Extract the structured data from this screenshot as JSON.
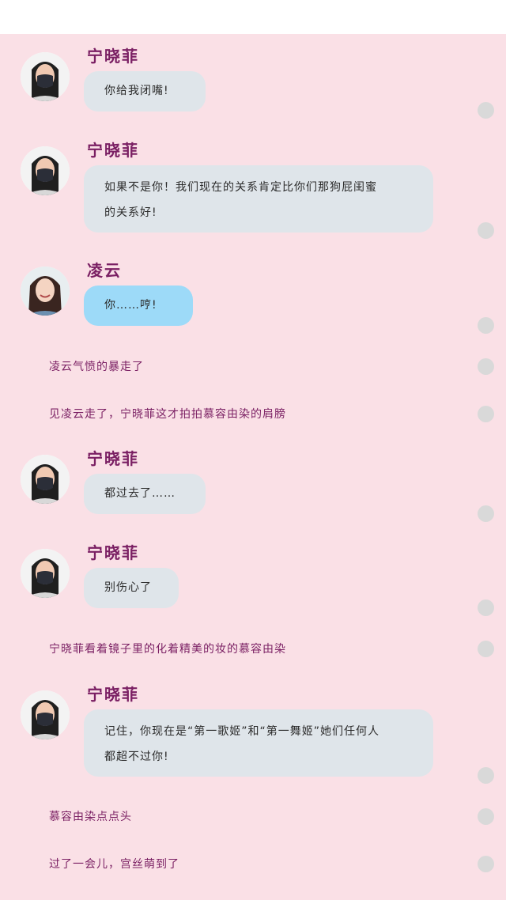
{
  "messages": [
    {
      "speaker": "宁晓菲",
      "text": "你给我闭嘴!"
    },
    {
      "speaker": "宁晓菲",
      "text_line1": "如果不是你！我们现在的关系肯定比你们那狗屁闺蜜",
      "text_line2": "的关系好!"
    },
    {
      "speaker": "凌云",
      "text": "你……哼!"
    },
    {
      "speaker": "宁晓菲",
      "text": "都过去了……"
    },
    {
      "speaker": "宁晓菲",
      "text": "别伤心了"
    },
    {
      "speaker": "宁晓菲",
      "text_line1": "记住，你现在是“第一歌姬”和“第一舞姬”她们任何人",
      "text_line2": "都超不过你!"
    }
  ],
  "narrations": [
    "凌云气愤的暴走了",
    "见凌云走了，宁晓菲这才拍拍慕容由染的肩膀",
    "宁晓菲看着镜子里的化着精美的妆的慕容由染",
    "慕容由染点点头",
    "过了一会儿，宫丝萌到了"
  ],
  "icons": {
    "avatar_ning": "avatar-masked-woman",
    "avatar_lingyun": "avatar-smiling-woman",
    "dot": "comment-dot-icon"
  },
  "colors": {
    "background": "#fae0e6",
    "name": "#7a1f63",
    "bubble_gray": "#dfe5ea",
    "bubble_blue": "#9ddaf8"
  }
}
